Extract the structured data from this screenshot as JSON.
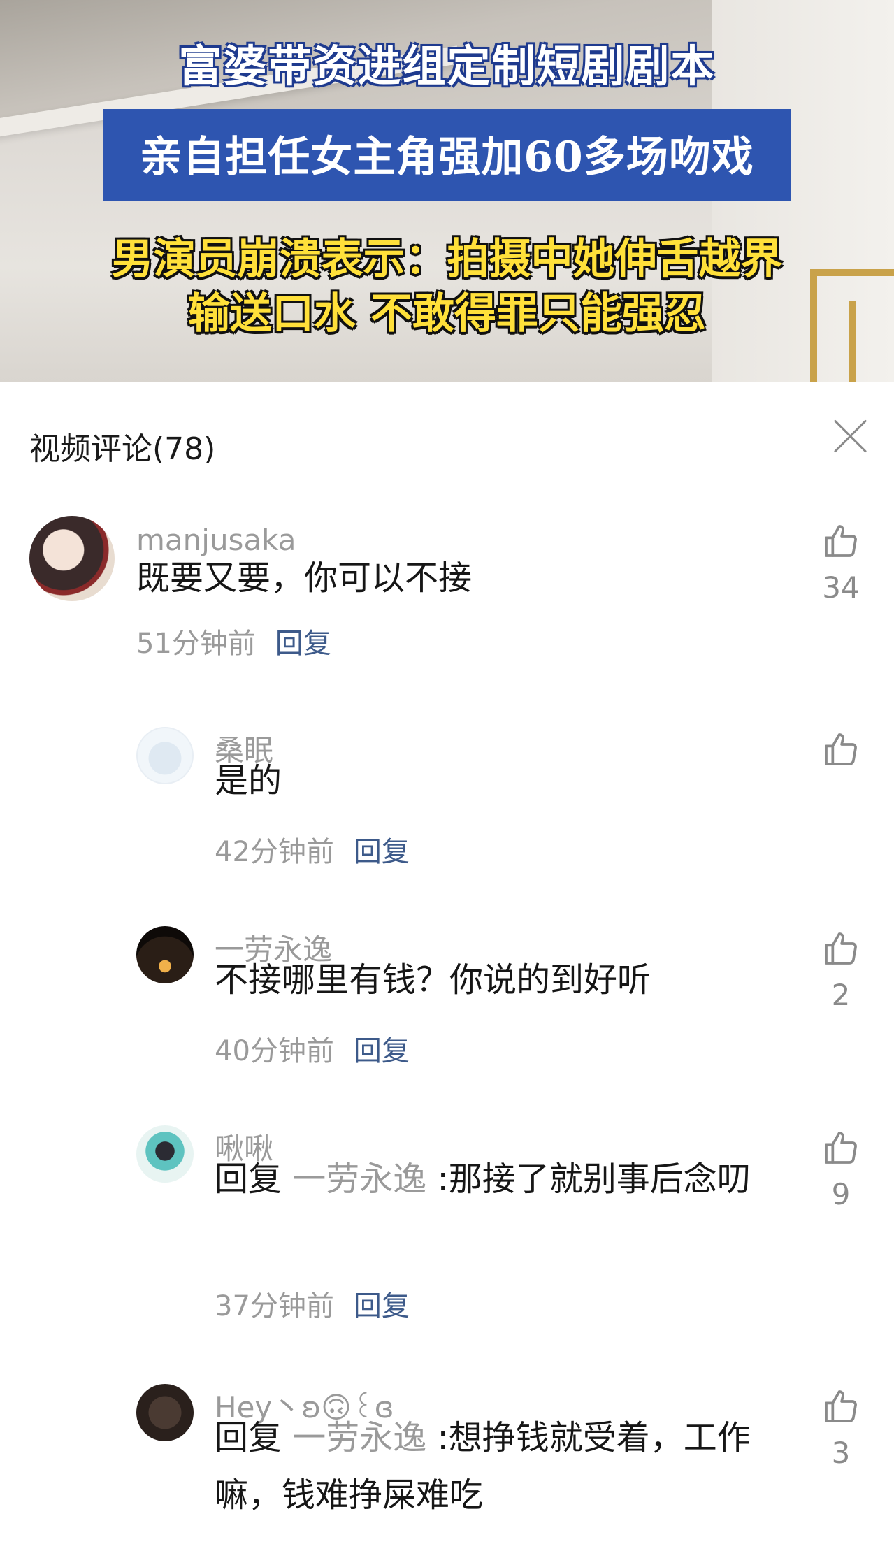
{
  "banner": {
    "line1": "富婆带资进组定制短剧剧本",
    "line2": "亲自担任女主角强加60多场吻戏",
    "line3": "男演员崩溃表示：拍摄中她伸舌越界",
    "line4": "输送口水 不敢得罪只能强忍"
  },
  "comments_header": {
    "title": "视频评论(78)"
  },
  "comments": [
    {
      "name": "manjusaka",
      "text": "既要又要，你可以不接",
      "time": "51分钟前",
      "reply": "回复",
      "likes": "34"
    },
    {
      "name": "桑眠",
      "text": "是的",
      "time": "42分钟前",
      "reply": "回复",
      "likes": ""
    },
    {
      "name": "一劳永逸",
      "text": "不接哪里有钱？你说的到好听",
      "time": "40分钟前",
      "reply": "回复",
      "likes": "2"
    },
    {
      "name": "啾啾",
      "reply_prefix": "回复 ",
      "reply_target": "一劳永逸",
      "text": " :那接了就别事后念叨",
      "time": "37分钟前",
      "reply": "回复",
      "likes": "9"
    },
    {
      "name": "Hey丶ʚ🙃꒰ɞ",
      "reply_prefix": "回复 ",
      "reply_target": "一劳永逸",
      "text": " :想挣钱就受着，工作嘛，钱难挣屎难吃",
      "time": "",
      "reply": "",
      "likes": "3"
    }
  ]
}
